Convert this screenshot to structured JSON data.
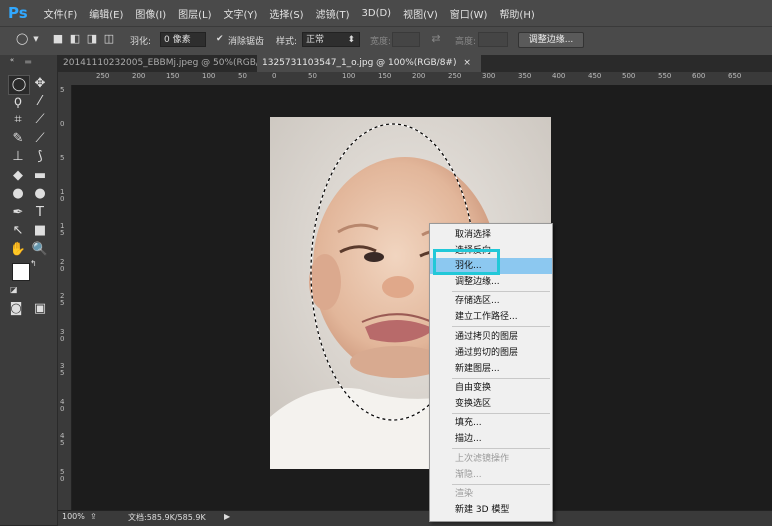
{
  "app": {
    "logo": "Ps",
    "accent": "#31a8ff"
  },
  "menubar": [
    "文件(F)",
    "编辑(E)",
    "图像(I)",
    "图层(L)",
    "文字(Y)",
    "选择(S)",
    "滤镜(T)",
    "3D(D)",
    "视图(V)",
    "窗口(W)",
    "帮助(H)"
  ],
  "options": {
    "feather_label": "羽化:",
    "feather_value": "0 像素",
    "antialias_label": "消除锯齿",
    "style_label": "样式:",
    "style_value": "正常",
    "width_label": "宽度:",
    "height_label": "高度:",
    "refine_edge": "调整边缘..."
  },
  "tabs": [
    {
      "label": "20141110232005_EBBMj.jpeg @ 50%(RGB/8)",
      "close": "×"
    },
    {
      "label": "1325731103547_1_o.jpg @ 100%(RGB/8#)",
      "close": "×"
    }
  ],
  "ruler": {
    "h_labels": [
      "250",
      "200",
      "150",
      "100",
      "50",
      "0",
      "50",
      "100",
      "150",
      "200",
      "250",
      "300",
      "350",
      "400",
      "450",
      "500",
      "550",
      "600",
      "650"
    ],
    "v_labels": [
      "5",
      "0",
      "5",
      "1 0",
      "1 5",
      "2 0",
      "2 5",
      "3 0",
      "3 5",
      "4 0",
      "4 5",
      "5 0"
    ]
  },
  "statusbar": {
    "zoom": "100%",
    "doc": "文档:585.9K/585.9K",
    "arrow": "▶"
  },
  "context_menu": [
    {
      "label": "取消选择",
      "disabled": false
    },
    {
      "label": "选择反向",
      "disabled": false
    },
    {
      "label": "羽化...",
      "disabled": false,
      "highlighted": true
    },
    {
      "label": "调整边缘...",
      "disabled": false
    },
    {
      "label": "存储选区...",
      "disabled": false
    },
    {
      "label": "建立工作路径...",
      "disabled": false
    },
    {
      "label": "通过拷贝的图层",
      "disabled": false
    },
    {
      "label": "通过剪切的图层",
      "disabled": false
    },
    {
      "label": "新建图层...",
      "disabled": false
    },
    {
      "label": "自由变换",
      "disabled": false
    },
    {
      "label": "变换选区",
      "disabled": false
    },
    {
      "label": "填充...",
      "disabled": false
    },
    {
      "label": "描边...",
      "disabled": false
    },
    {
      "label": "上次滤镜操作",
      "disabled": true
    },
    {
      "label": "渐隐...",
      "disabled": true
    },
    {
      "label": "渲染",
      "disabled": true
    },
    {
      "label": "新建 3D 模型",
      "disabled": false
    }
  ],
  "colors": {
    "highlight_box": "#22c8d8",
    "menu_highlight": "#8cc8f0"
  }
}
